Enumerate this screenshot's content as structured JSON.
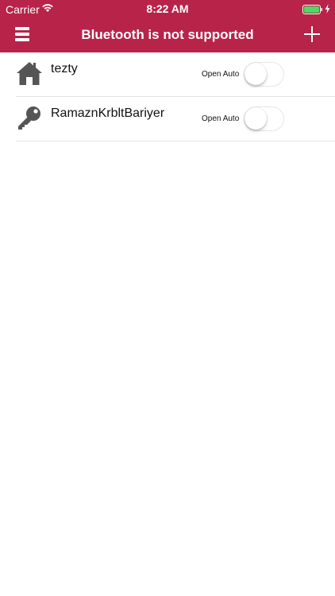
{
  "status_bar": {
    "carrier": "Carrier",
    "time": "8:22 AM"
  },
  "navbar": {
    "title": "Bluetooth is not supported",
    "menu_icon": "hamburger-menu-icon",
    "add_icon": "plus-icon"
  },
  "devices": [
    {
      "name": "tezty",
      "icon": "house-icon",
      "open_auto_label": "Open Auto",
      "open_auto_on": false
    },
    {
      "name": "RamaznKrbltBariyer",
      "icon": "key-icon",
      "open_auto_label": "Open Auto",
      "open_auto_on": false
    }
  ],
  "colors": {
    "brand": "#b8234a",
    "battery": "#4cd964",
    "icon_gray": "#555555"
  }
}
